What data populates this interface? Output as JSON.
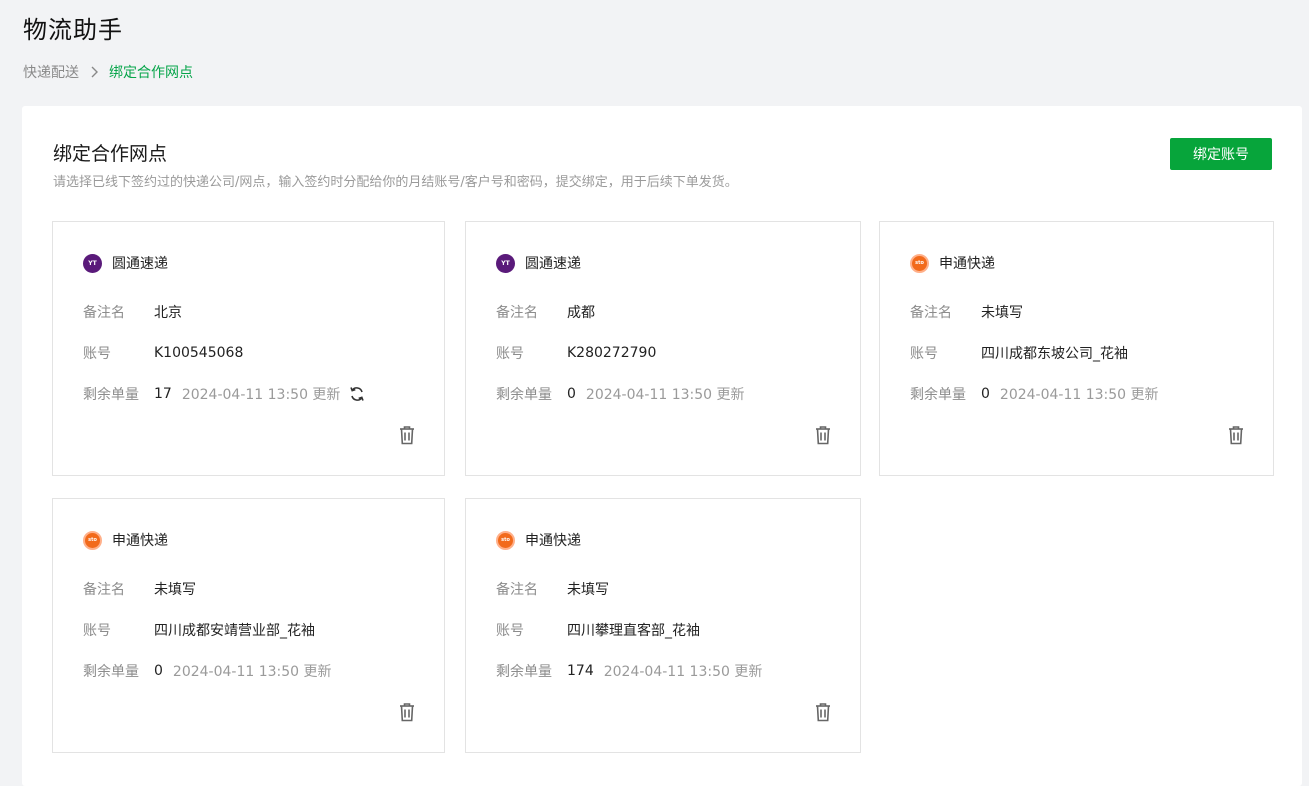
{
  "app": {
    "title": "物流助手"
  },
  "breadcrumb": {
    "parent": "快递配送",
    "current": "绑定合作网点"
  },
  "panel": {
    "title": "绑定合作网点",
    "description": "请选择已线下签约过的快递公司/网点，输入签约时分配给你的月结账号/客户号和密码，提交绑定，用于后续下单发货。",
    "bind_button_label": "绑定账号"
  },
  "labels": {
    "remark": "备注名",
    "account": "账号",
    "remaining": "剩余单量",
    "updated_suffix": "更新"
  },
  "cards": [
    {
      "company": "圆通速递",
      "logo": "yto-logo-icon",
      "remark": "北京",
      "account": "K100545068",
      "remaining": "17",
      "updated": "2024-04-11 13:50 更新",
      "show_refresh": true
    },
    {
      "company": "圆通速递",
      "logo": "yto-logo-icon",
      "remark": "成都",
      "account": "K280272790",
      "remaining": "0",
      "updated": "2024-04-11 13:50 更新",
      "show_refresh": false
    },
    {
      "company": "申通快递",
      "logo": "sto-logo-icon",
      "remark": "未填写",
      "account": "四川成都东坡公司_花袖",
      "remaining": "0",
      "updated": "2024-04-11 13:50 更新",
      "show_refresh": false
    },
    {
      "company": "申通快递",
      "logo": "sto-logo-icon",
      "remark": "未填写",
      "account": "四川成都安靖营业部_花袖",
      "remaining": "0",
      "updated": "2024-04-11 13:50 更新",
      "show_refresh": false
    },
    {
      "company": "申通快递",
      "logo": "sto-logo-icon",
      "remark": "未填写",
      "account": "四川攀理直客部_花袖",
      "remaining": "174",
      "updated": "2024-04-11 13:50 更新",
      "show_refresh": false
    }
  ],
  "colors": {
    "accent": "#07a53b",
    "link_active": "#07a54a",
    "yto": "#5a1a7a",
    "sto": "#f26a1b"
  }
}
